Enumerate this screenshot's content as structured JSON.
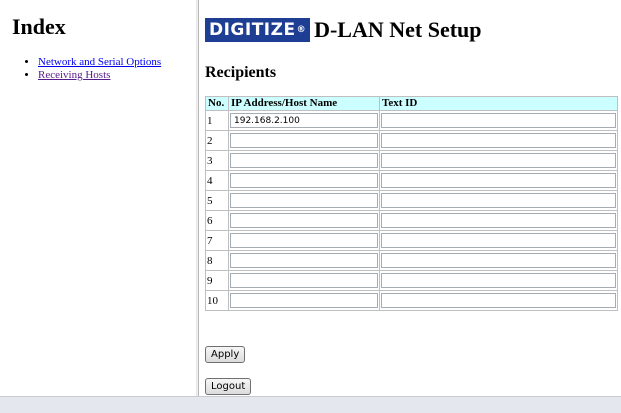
{
  "index": {
    "title": "Index",
    "links": [
      {
        "label": "Network and Serial Options"
      },
      {
        "label": "Receiving Hosts"
      }
    ]
  },
  "header": {
    "logo_text": "DIGITIZE",
    "logo_mark": "®",
    "title": "D-LAN Net Setup"
  },
  "section_title": "Recipients",
  "table": {
    "columns": [
      "No.",
      "IP Address/Host Name",
      "Text ID"
    ],
    "rows": [
      {
        "no": "1",
        "ip": "192.168.2.100",
        "text_id": ""
      },
      {
        "no": "2",
        "ip": "",
        "text_id": ""
      },
      {
        "no": "3",
        "ip": "",
        "text_id": ""
      },
      {
        "no": "4",
        "ip": "",
        "text_id": ""
      },
      {
        "no": "5",
        "ip": "",
        "text_id": ""
      },
      {
        "no": "6",
        "ip": "",
        "text_id": ""
      },
      {
        "no": "7",
        "ip": "",
        "text_id": ""
      },
      {
        "no": "8",
        "ip": "",
        "text_id": ""
      },
      {
        "no": "9",
        "ip": "",
        "text_id": ""
      },
      {
        "no": "10",
        "ip": "",
        "text_id": ""
      }
    ]
  },
  "buttons": {
    "apply": "Apply",
    "logout": "Logout"
  },
  "colors": {
    "header_row": "#ccffff",
    "logo_bg": "#1d3e93",
    "link": "#0000ee",
    "visited_link": "#551a8b"
  }
}
